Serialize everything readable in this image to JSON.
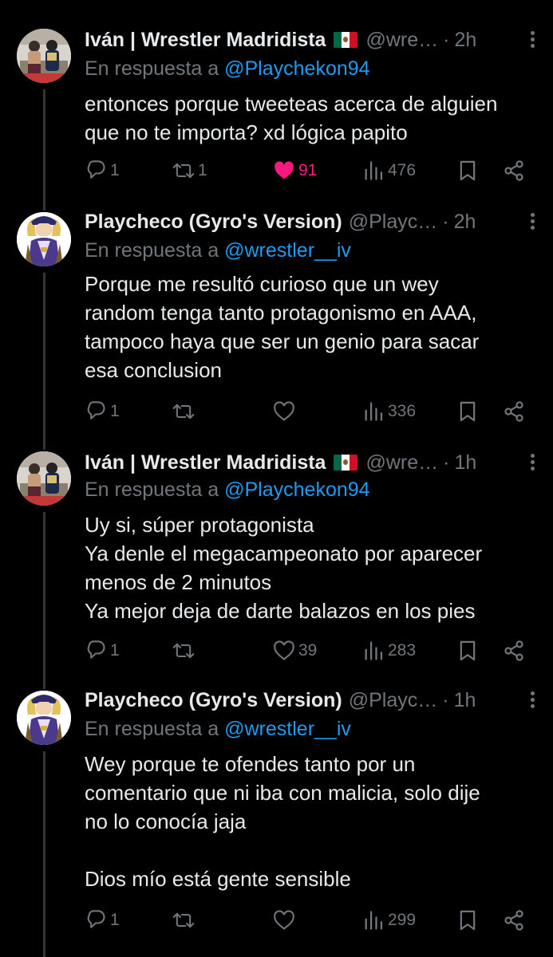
{
  "tweets": [
    {
      "author": "Iván | Wrestler Madridista",
      "flag": "mexico-flag-icon",
      "handle": "@wre…",
      "time": "2h",
      "reply_label": "En respuesta a",
      "reply_to": "@Playchekon94",
      "text": "entonces porque tweeteas acerca de alguien\nque no te importa? xd lógica papito",
      "replies": "1",
      "retweets": "1",
      "likes": "91",
      "liked": true,
      "views": "476"
    },
    {
      "author": "Playcheco (Gyro's Version)",
      "handle": "@Playc…",
      "time": "2h",
      "reply_label": "En respuesta a",
      "reply_to": "@wrestler__iv",
      "text": "Porque me resultó curioso que un wey\nrandom tenga tanto protagonismo en AAA,\ntampoco haya que ser un genio para sacar\nesa conclusion",
      "replies": "1",
      "retweets": "",
      "likes": "",
      "liked": false,
      "views": "336"
    },
    {
      "author": "Iván | Wrestler Madridista",
      "flag": "mexico-flag-icon",
      "handle": "@wre…",
      "time": "1h",
      "reply_label": "En respuesta a",
      "reply_to": "@Playchekon94",
      "text": "Uy si, súper protagonista\nYa denle el megacampeonato por aparecer\nmenos de 2 minutos\nYa mejor deja de darte balazos en los pies",
      "replies": "1",
      "retweets": "",
      "likes": "39",
      "liked": false,
      "views": "283"
    },
    {
      "author": "Playcheco (Gyro's Version)",
      "handle": "@Playc…",
      "time": "1h",
      "reply_label": "En respuesta a",
      "reply_to": "@wrestler__iv",
      "text": "Wey porque te ofendes tanto por un\ncomentario que ni iba con malicia, solo dije\nno lo conocía jaja\n\nDios mío está gente sensible",
      "replies": "1",
      "retweets": "",
      "likes": "",
      "liked": false,
      "views": "299"
    }
  ],
  "colors": {
    "background": "#000000",
    "text": "#e7e9ea",
    "muted": "#71767b",
    "link": "#1d9bf0",
    "like": "#f91880",
    "thread_line": "#333639"
  }
}
